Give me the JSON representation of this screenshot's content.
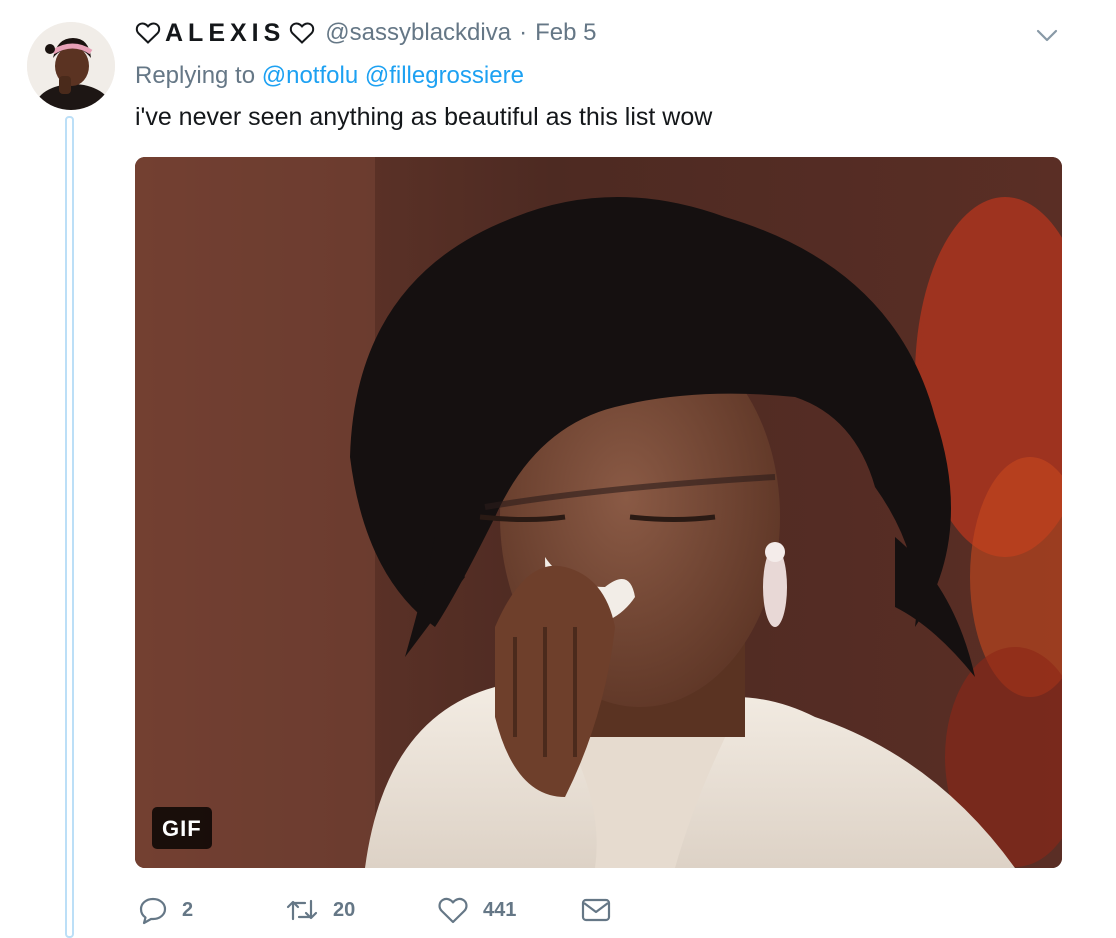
{
  "tweet": {
    "display_name": "ALEXIS",
    "handle": "@sassyblackdiva",
    "separator": "·",
    "date": "Feb 5",
    "replying_prefix": "Replying to",
    "reply_mentions": [
      "@notfolu",
      "@fillegrossiere"
    ],
    "text": "i've never seen anything as beautiful as this list wow",
    "media": {
      "badge": "GIF"
    },
    "actions": {
      "replies": "2",
      "retweets": "20",
      "likes": "441"
    }
  },
  "icons": {
    "name_decoration": "heart-outline-icon",
    "menu": "chevron-down-icon",
    "reply": "reply-bubble-icon",
    "retweet": "retweet-icon",
    "like": "heart-icon",
    "message": "envelope-icon"
  },
  "colors": {
    "link": "#1da1f2",
    "secondary_text": "#657786",
    "primary_text": "#14171a",
    "thread_line": "#bcdff7"
  }
}
